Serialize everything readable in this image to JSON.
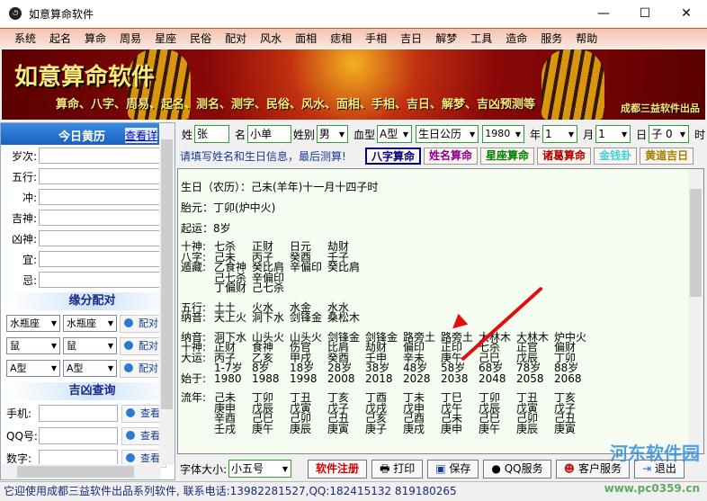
{
  "window": {
    "title": "如意算命软件",
    "min": "—",
    "max": "☐",
    "close": "✕"
  },
  "menu": [
    "系统",
    "起名",
    "算命",
    "周易",
    "星座",
    "民俗",
    "配对",
    "风水",
    "面相",
    "痣相",
    "手相",
    "吉日",
    "解梦",
    "工具",
    "造命",
    "服务",
    "帮助"
  ],
  "banner": {
    "title": "如意算命软件",
    "subtitle": "算命、八字、周易、起名、测名、测字、民俗、风水、面相、手相、吉日、解梦、吉凶预测等",
    "maker": "成都三益软件出品"
  },
  "left": {
    "header": "今日黄历",
    "detail_link": "查看详",
    "fields": [
      "岁次:",
      "五行:",
      "冲:",
      "吉神:",
      "凶神:",
      "宜:",
      "忌:"
    ],
    "pair_title": "缘分配对",
    "pairs": [
      {
        "a": "水瓶座",
        "b": "水瓶座",
        "btn": "配对"
      },
      {
        "a": "鼠",
        "b": "鼠",
        "btn": "配对"
      },
      {
        "a": "A型",
        "b": "A型",
        "btn": "配对"
      }
    ],
    "query_title": "吉凶查询",
    "queries": [
      {
        "label": "手机:",
        "btn": "查看"
      },
      {
        "label": "QQ号:",
        "btn": "查看"
      },
      {
        "label": "数字:",
        "btn": "查看"
      }
    ]
  },
  "form": {
    "surname_label": "姓",
    "surname": "张",
    "name_label": "名",
    "name": "小单",
    "gender_label": "姓别",
    "gender": "男",
    "blood_label": "血型",
    "blood": "A型",
    "calendar": "生日公历",
    "year": "1980",
    "year_label": "年",
    "month": "1",
    "month_label": "月",
    "day": "1",
    "day_label": "日",
    "hour": "子 0",
    "hour_label": "时",
    "hint": "请填写姓名和生日信息，最后测算!",
    "buttons": [
      {
        "label": "八字算命",
        "color": "#000080"
      },
      {
        "label": "姓名算命",
        "color": "#900090"
      },
      {
        "label": "星座算命",
        "color": "#008000"
      },
      {
        "label": "诸葛算命",
        "color": "#b00000"
      },
      {
        "label": "金钱卦",
        "color": "#40d0e0"
      },
      {
        "label": "黄道吉日",
        "color": "#a08000"
      }
    ]
  },
  "result": {
    "birthday": "生日（农历）：己未(羊年)十一月十四子时",
    "taiyuan": "胎元：丁卯(炉中火)",
    "qiyun": "起运：8岁",
    "pillars": [
      {
        "label": "十神:",
        "cells": [
          "七杀",
          "正财",
          "日元",
          "劫财"
        ]
      },
      {
        "label": "八字:",
        "cells": [
          "己未",
          "丙子",
          "癸酉",
          "壬子"
        ]
      },
      {
        "label": "遁藏:",
        "cells": [
          "乙食神",
          "癸比肩",
          "辛偏印",
          "癸比肩"
        ]
      },
      {
        "label": "",
        "cells": [
          "己七杀",
          "辛偏印"
        ]
      },
      {
        "label": "",
        "cells": [
          "丁偏财",
          "己七杀"
        ]
      }
    ],
    "wuxing": [
      {
        "label": "五行:",
        "cells": [
          "土土",
          "火水",
          "水金",
          "水水"
        ]
      },
      {
        "label": "纳音:",
        "cells": [
          "天上火",
          "洞下水",
          "剑锋金",
          "桑松木"
        ]
      }
    ],
    "dayun": [
      {
        "label": "纳音:",
        "cells": [
          "洞下水",
          "山头火",
          "山头火",
          "剑锋金",
          "剑锋金",
          "路旁土",
          "路旁土",
          "大林木",
          "大林木",
          "炉中火"
        ]
      },
      {
        "label": "十神:",
        "cells": [
          "正财",
          "食神",
          "伤官",
          "比肩",
          "劫财",
          "偏印",
          "正印",
          "七杀",
          "正官",
          "偏财"
        ]
      },
      {
        "label": "大运:",
        "cells": [
          "丙子",
          "乙亥",
          "甲戌",
          "癸酉",
          "壬申",
          "辛未",
          "庚午",
          "己巳",
          "戊辰",
          "丁卯"
        ]
      },
      {
        "label": "",
        "cells": [
          "1-7岁",
          "8岁",
          "18岁",
          "28岁",
          "38岁",
          "48岁",
          "58岁",
          "68岁",
          "78岁",
          "88岁"
        ]
      },
      {
        "label": "始于:",
        "cells": [
          "1980",
          "1988",
          "1998",
          "2008",
          "2018",
          "2028",
          "2038",
          "2048",
          "2058",
          "2068"
        ]
      }
    ],
    "liunian": [
      {
        "label": "流年:",
        "cells": [
          "己未",
          "丁卯",
          "丁丑",
          "丁亥",
          "丁酉",
          "丁未",
          "丁巳",
          "丁卯",
          "丁丑",
          "丁亥"
        ]
      },
      {
        "label": "",
        "cells": [
          "庚申",
          "戊辰",
          "戊寅",
          "戊子",
          "戊戌",
          "戊申",
          "戊午",
          "戊辰",
          "戊寅",
          "戊子"
        ]
      },
      {
        "label": "",
        "cells": [
          "辛酉",
          "己巳",
          "己卯",
          "己丑",
          "己亥",
          "己酉",
          "己未",
          "己巳",
          "己卯",
          "己丑"
        ]
      },
      {
        "label": "",
        "cells": [
          "壬戌",
          "庚午",
          "庚辰",
          "庚寅",
          "庚子",
          "庚戌",
          "庚申",
          "庚午",
          "庚辰",
          "庚寅"
        ]
      }
    ]
  },
  "bottom": {
    "font_label": "字体大小:",
    "font_value": "小五号",
    "register": "软件注册",
    "print": "打印",
    "save": "保存",
    "qq": "QQ服务",
    "service": "客户服务",
    "exit": "退出"
  },
  "status": "它迎使用成都三益软件出品系列软件, 联系电话:13982281527,QQ:182415132 819180265",
  "watermark": {
    "text": "河东软件园",
    "url": "www.pc0359.cn"
  }
}
